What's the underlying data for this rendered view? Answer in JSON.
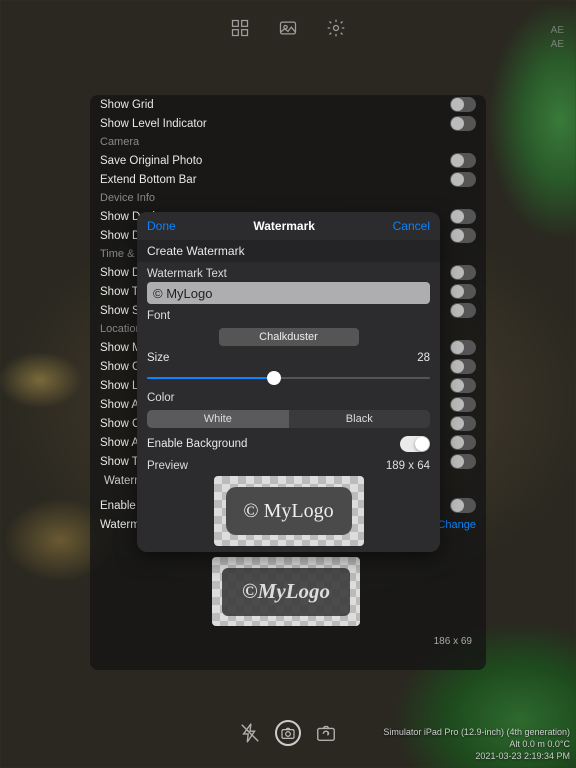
{
  "topbar": {
    "icons": [
      "grid-icon",
      "image-icon",
      "gear-icon"
    ]
  },
  "ae": {
    "line1": "AE",
    "line2": "AE"
  },
  "panel": {
    "rows": [
      {
        "kind": "item",
        "label": "Show Grid",
        "toggle": false
      },
      {
        "kind": "item",
        "label": "Show Level Indicator",
        "toggle": false
      },
      {
        "kind": "section",
        "label": "Camera"
      },
      {
        "kind": "item",
        "label": "Save Original Photo",
        "toggle": false
      },
      {
        "kind": "item",
        "label": "Extend Bottom Bar",
        "toggle": false
      },
      {
        "kind": "section",
        "label": "Device Info"
      },
      {
        "kind": "item",
        "label": "Show Device",
        "toggle": false
      },
      {
        "kind": "item",
        "label": "Show Device",
        "toggle": false
      },
      {
        "kind": "section",
        "label": "Time & Date"
      },
      {
        "kind": "item",
        "label": "Show Date",
        "toggle": false
      },
      {
        "kind": "item",
        "label": "Show Time",
        "toggle": false
      },
      {
        "kind": "item",
        "label": "Show Seconds",
        "toggle": false
      },
      {
        "kind": "section",
        "label": "Location"
      },
      {
        "kind": "item",
        "label": "Show Map",
        "toggle": false
      },
      {
        "kind": "item",
        "label": "Show GPS",
        "toggle": false
      },
      {
        "kind": "item",
        "label": "Show Location",
        "toggle": false
      },
      {
        "kind": "item",
        "label": "Show Address",
        "toggle": false
      },
      {
        "kind": "item",
        "label": "Show Coordinates",
        "toggle": false
      },
      {
        "kind": "item",
        "label": "Show Altitude",
        "toggle": false
      },
      {
        "kind": "item",
        "label": "Show Temperature",
        "toggle": false
      },
      {
        "kind": "indent",
        "label": "Watermark"
      },
      {
        "kind": "spacer"
      },
      {
        "kind": "item",
        "label": "Enable Watermark",
        "toggle": false
      },
      {
        "kind": "item",
        "label": "Watermark",
        "link": "Change"
      }
    ],
    "preview_text": "©MyLogo",
    "preview_dim": "186 x 69"
  },
  "modal": {
    "done": "Done",
    "cancel": "Cancel",
    "title": "Watermark",
    "subtitle": "Create Watermark",
    "labels": {
      "watermark_text": "Watermark Text",
      "font": "Font",
      "size": "Size",
      "color": "Color",
      "enable_bg": "Enable Background",
      "preview": "Preview"
    },
    "text_value": "© MyLogo",
    "font_value": "Chalkduster",
    "size_value": "28",
    "slider_percent": 45,
    "color_options": {
      "white": "White",
      "black": "Black"
    },
    "color_selected": "white",
    "enable_bg_on": true,
    "preview_dim": "189 x 64",
    "preview_text": "© MyLogo"
  },
  "bottom": {
    "info": {
      "line1": "Simulator iPad Pro (12.9-inch) (4th generation)",
      "line2": "Alt 0.0 m 0.0°C",
      "line3": "2021-03-23 2:19:34 PM"
    }
  }
}
